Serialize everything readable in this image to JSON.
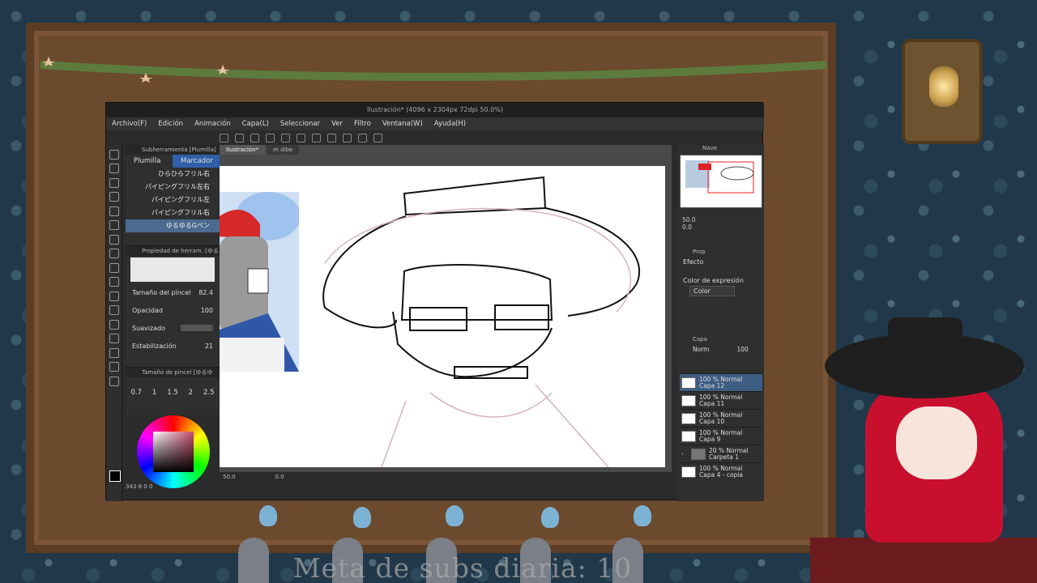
{
  "window": {
    "title": "Ilustración* (4096 x 2304px 72dpi 50.0%)"
  },
  "menu": [
    "Archivo(F)",
    "Edición",
    "Animación",
    "Capa(L)",
    "Seleccionar",
    "Ver",
    "Filtro",
    "Ventana(W)",
    "Ayuda(H)"
  ],
  "doc_tabs": [
    "Ilustración*",
    "m dibe"
  ],
  "subtool": {
    "header": "Subherramienta [Plumilla]",
    "tabs": [
      "Plumilla",
      "Marcador"
    ],
    "items": [
      "ひらひらフリル右",
      "パイピングフリル左右",
      "パイピングフリル左",
      "パイピングフリル右",
      "ゆるゆるGペン"
    ]
  },
  "tool_property": {
    "header": "Propiedad de herram. [ゆる",
    "size_label": "Tamaño del pincel",
    "size_value": "82.4",
    "opacity_label": "Opacidad",
    "opacity_value": "100",
    "smoothing_label": "Suavizado",
    "stabilization_label": "Estabilización",
    "stabilization_value": "21"
  },
  "brush_size": {
    "header": "Tamaño de pincel [ゆるゆ",
    "values": [
      "0.7",
      "1",
      "1.5",
      "2",
      "2.5"
    ]
  },
  "statusbar": {
    "zoom": "50.0",
    "rotation": "0.0",
    "color_info": "343 8  0  0"
  },
  "navigator": {
    "label": "Nave",
    "zoom": "50.0",
    "angle": "0.0"
  },
  "effects": {
    "header": "Prop",
    "effect_label": "Efecto",
    "expression_label": "Color de expresión",
    "expression_value": "Color"
  },
  "layers": {
    "header": "Capa",
    "blend": "Norm",
    "opacity": "100",
    "items": [
      {
        "mode": "100 % Normal",
        "name": "Capa 12"
      },
      {
        "mode": "100 % Normal",
        "name": "Capa 11"
      },
      {
        "mode": "100 % Normal",
        "name": "Capa 10"
      },
      {
        "mode": "100 % Normal",
        "name": "Capa 9"
      },
      {
        "mode": "20 % Normal",
        "name": "Carpeta 1"
      },
      {
        "mode": "100 % Normal",
        "name": "Capa 4 - copia"
      }
    ]
  },
  "overlay": {
    "goal_text": "Meta de subs diaria: 10"
  }
}
